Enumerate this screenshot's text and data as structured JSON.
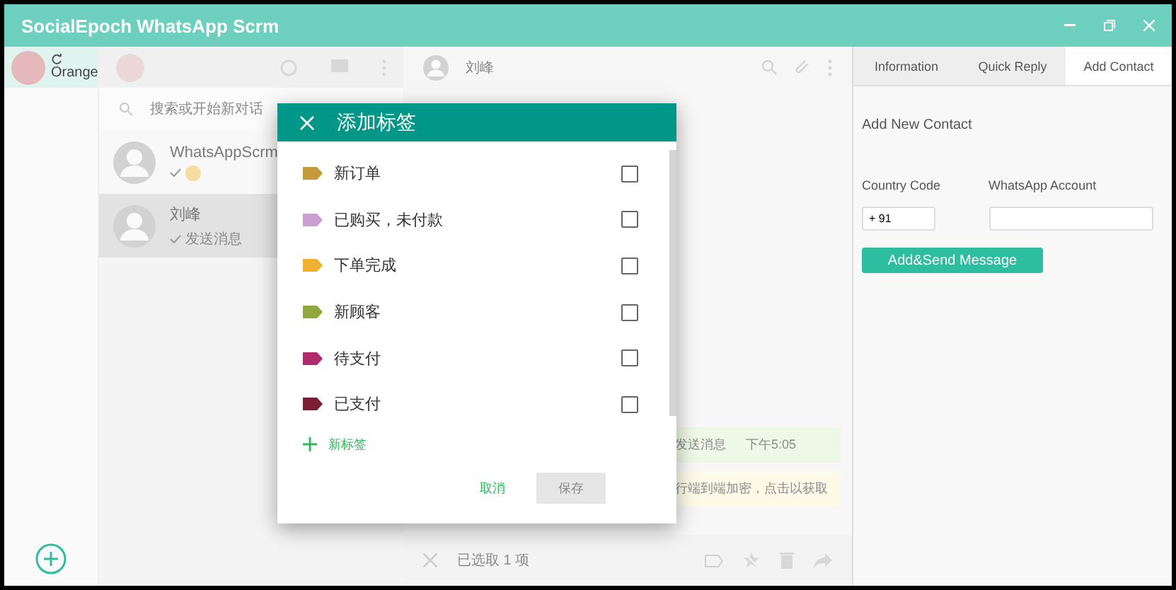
{
  "window": {
    "title": "SocialEpoch WhatsApp Scrm"
  },
  "account": {
    "name": "Orange"
  },
  "chat_list": {
    "search": {
      "placeholder": "搜索或开始新对话"
    },
    "items": [
      {
        "name": "WhatsAppScrm",
        "selected": false
      },
      {
        "name": "刘峰",
        "preview": "发送消息",
        "selected": true
      }
    ]
  },
  "chat": {
    "contact": "刘峰",
    "messages": [
      {
        "kind": "outgoing",
        "text": "发送消息",
        "time": "下午5:05"
      },
      {
        "kind": "notice",
        "text": "行端到端加密，点击以获取"
      }
    ],
    "selection_bar": {
      "text": "已选取 1 项"
    }
  },
  "dialog": {
    "title": "添加标签",
    "labels": [
      {
        "name": "新订单",
        "color": "#c49a3a",
        "checked": false
      },
      {
        "name": "已购买，未付款",
        "color": "#c9a0d0",
        "checked": false
      },
      {
        "name": "下单完成",
        "color": "#f0b030",
        "checked": false
      },
      {
        "name": "新顾客",
        "color": "#8fa840",
        "checked": false
      },
      {
        "name": "待支付",
        "color": "#b02a6e",
        "checked": false
      },
      {
        "name": "已支付",
        "color": "#7a2035",
        "checked": false
      }
    ],
    "new_label": "新标签",
    "cancel": "取消",
    "save": "保存"
  },
  "panel": {
    "tabs": [
      {
        "label": "Information",
        "selected": false
      },
      {
        "label": "Quick Reply",
        "selected": false
      },
      {
        "label": "Add Contact",
        "selected": true
      }
    ],
    "heading": "Add New Contact",
    "fields": [
      {
        "label": "Country Code",
        "value": "+ 91"
      },
      {
        "label": "WhatsApp Account"
      }
    ],
    "button": "Add&Send Message"
  }
}
